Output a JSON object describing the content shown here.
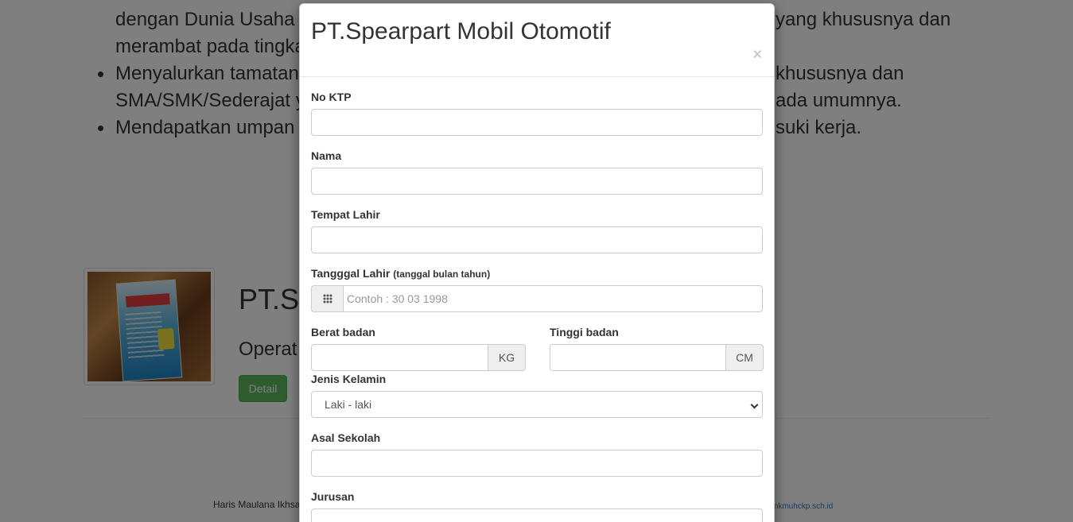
{
  "background": {
    "line1": "dengan Dunia Usaha",
    "line1_right": "yang khususnya dan",
    "line2": "merambat pada tingka",
    "bullets": [
      {
        "left": "Menyalurkan tamatan",
        "right": "khususnya dan"
      },
      {
        "left": "SMA/SMK/Sederajat y",
        "right": "ada umumnya."
      },
      {
        "left": "Mendapatkan umpan",
        "right": "suki kerja."
      }
    ],
    "card_title": "PT.S",
    "card_subtitle": "Operat",
    "detail_button": "Detail",
    "footer_left": "Haris Maulana Ikhsa",
    "footer_right": "smkmuhckp.sch.id"
  },
  "modal": {
    "title": "PT.Spearpart Mobil Otomotif",
    "close": "×",
    "fields": {
      "no_ktp": {
        "label": "No KTP",
        "value": ""
      },
      "nama": {
        "label": "Nama",
        "value": ""
      },
      "tempat_lahir": {
        "label": "Tempat Lahir",
        "value": ""
      },
      "tanggal_lahir": {
        "label": "Tangggal Lahir",
        "hint": "(tanggal bulan tahun)",
        "placeholder": "Contoh : 30 03 1998",
        "icon": "calendar-grid-icon"
      },
      "berat_badan": {
        "label": "Berat badan",
        "addon": "KG",
        "value": ""
      },
      "tinggi_badan": {
        "label": "Tinggi badan",
        "addon": "CM",
        "value": ""
      },
      "jenis_kelamin": {
        "label": "Jenis Kelamin",
        "selected": "Laki - laki"
      },
      "asal_sekolah": {
        "label": "Asal Sekolah",
        "value": ""
      },
      "jurusan": {
        "label": "Jurusan",
        "value": ""
      }
    }
  }
}
